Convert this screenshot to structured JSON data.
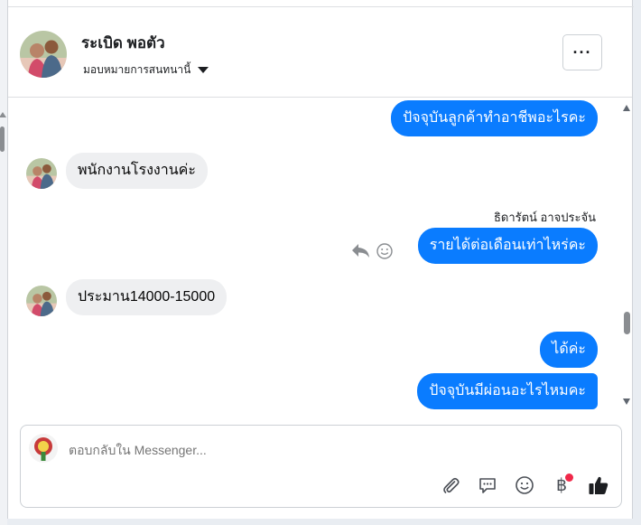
{
  "header": {
    "contact_name": "ระเบิด พอตัว",
    "assign_label": "มอบหมายการสนทนานี้",
    "more_label": "···"
  },
  "messages": [
    {
      "direction": "outgoing",
      "text": "ปัจจุบันลูกค้าทำอาชีพอะไรคะ"
    },
    {
      "direction": "incoming",
      "text": "พนักงานโรงงานค่ะ"
    },
    {
      "direction": "outgoing",
      "sender": "ธิดารัตน์ อาจประจัน",
      "text": "รายได้ต่อเดือนเท่าไหร่คะ"
    },
    {
      "direction": "incoming",
      "text": "ประมาน14000-15000"
    },
    {
      "direction": "outgoing",
      "text": "ได้ค่ะ"
    },
    {
      "direction": "outgoing",
      "text": "ปัจจุบันมีผ่อนอะไรไหมคะ"
    }
  ],
  "composer": {
    "placeholder": "ตอบกลับใน Messenger...",
    "currency_symbol": "฿",
    "tools": [
      "attach-icon",
      "saved-replies-icon",
      "emoji-icon",
      "payment-icon",
      "like-icon"
    ]
  },
  "colors": {
    "outgoing_bubble": "#0a7cff",
    "incoming_bubble": "#eeeff1",
    "notification_dot": "#f02849"
  }
}
